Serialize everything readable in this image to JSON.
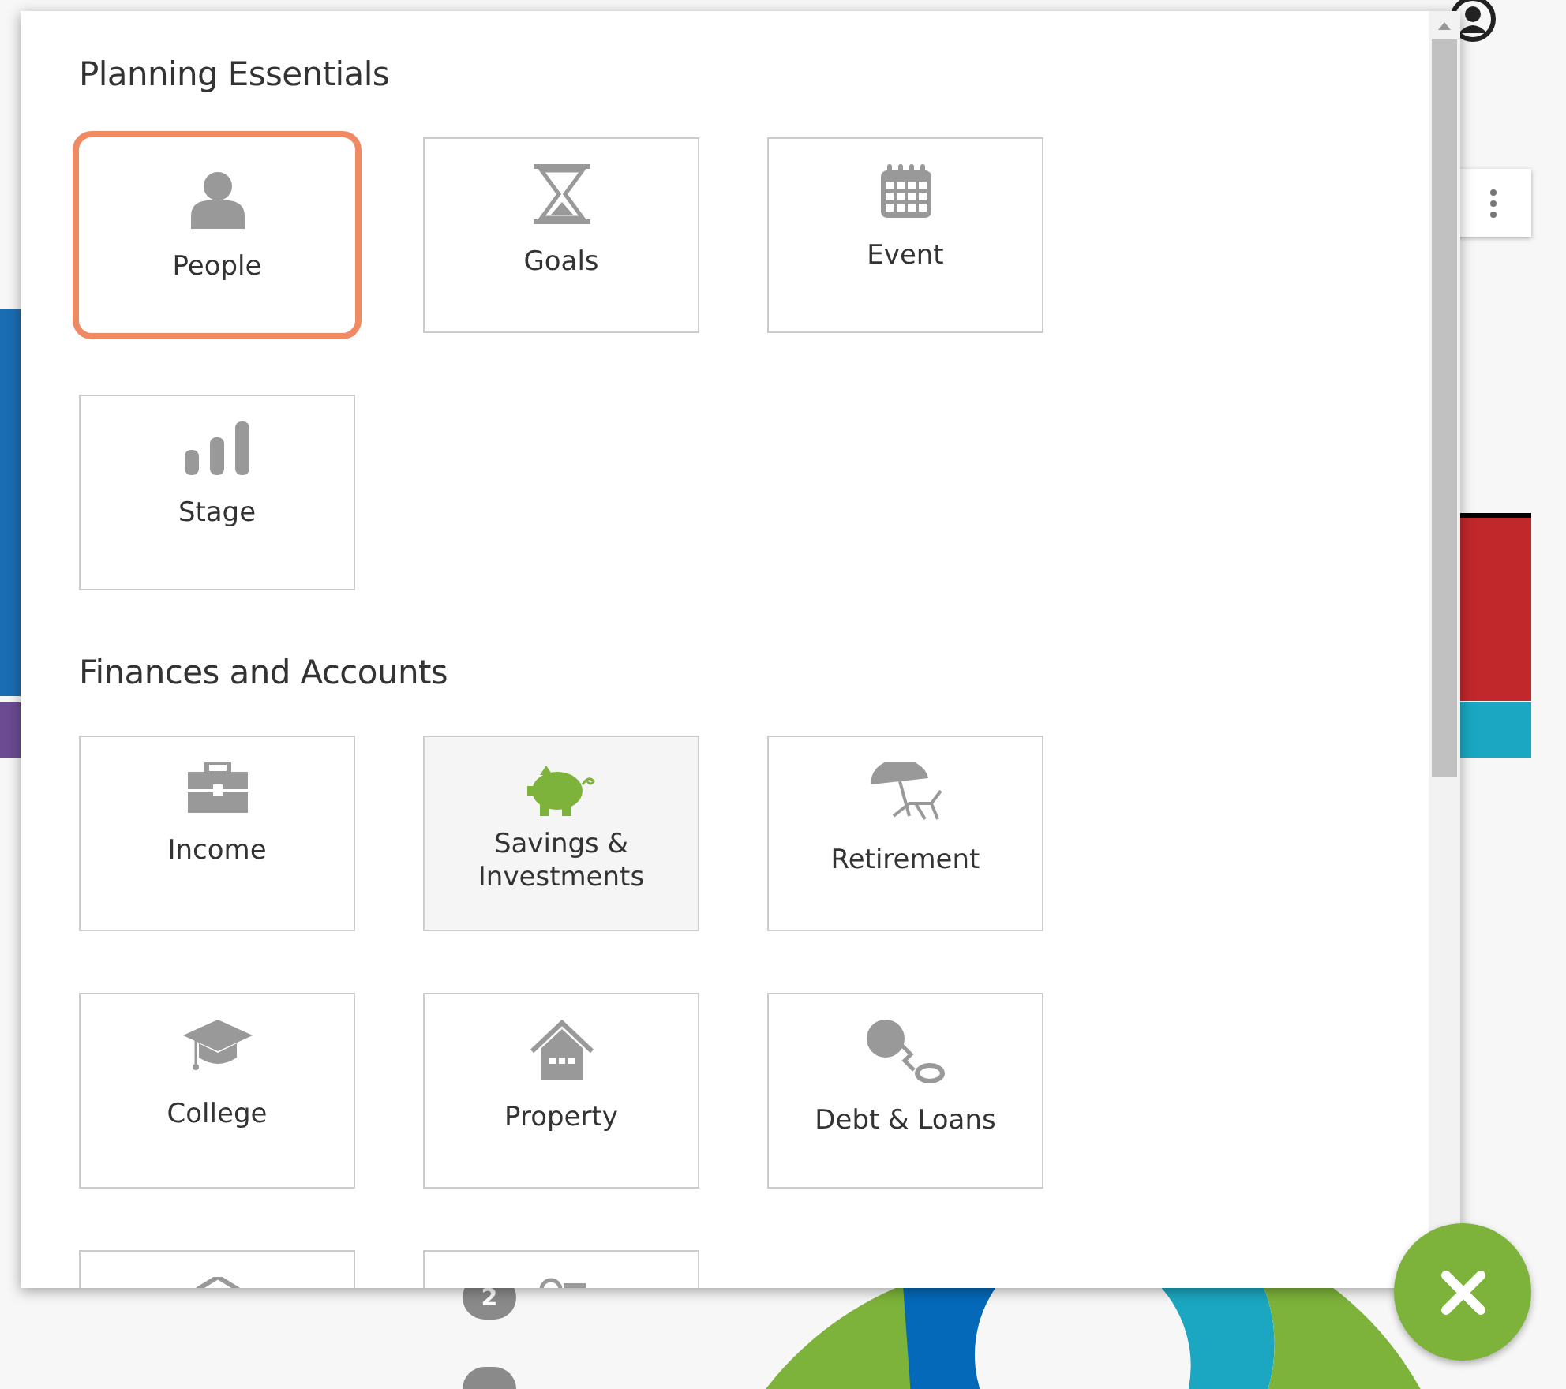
{
  "background": {
    "badges": [
      "2"
    ]
  },
  "dialog": {
    "sections": [
      {
        "title": "Planning Essentials",
        "tiles": [
          {
            "kind": "tile",
            "label": "People",
            "selected": true,
            "highlighted": false
          },
          {
            "kind": "tile",
            "label": "Goals",
            "selected": false,
            "highlighted": false
          },
          {
            "kind": "tile",
            "label": "Event",
            "selected": false,
            "highlighted": false
          },
          {
            "kind": "tile",
            "label": "Stage",
            "selected": false,
            "highlighted": false
          }
        ]
      },
      {
        "title": "Finances and Accounts",
        "tiles": [
          {
            "kind": "tile",
            "label": "Income",
            "selected": false,
            "highlighted": false
          },
          {
            "kind": "tile",
            "label": "Savings & Investments",
            "selected": false,
            "highlighted": true
          },
          {
            "kind": "tile",
            "label": "Retirement",
            "selected": false,
            "highlighted": false
          },
          {
            "kind": "tile",
            "label": "College",
            "selected": false,
            "highlighted": false
          },
          {
            "kind": "tile",
            "label": "Property",
            "selected": false,
            "highlighted": false
          },
          {
            "kind": "tile",
            "label": "Debt & Loans",
            "selected": false,
            "highlighted": false
          },
          {
            "kind": "cut"
          },
          {
            "kind": "cut"
          }
        ]
      }
    ]
  }
}
